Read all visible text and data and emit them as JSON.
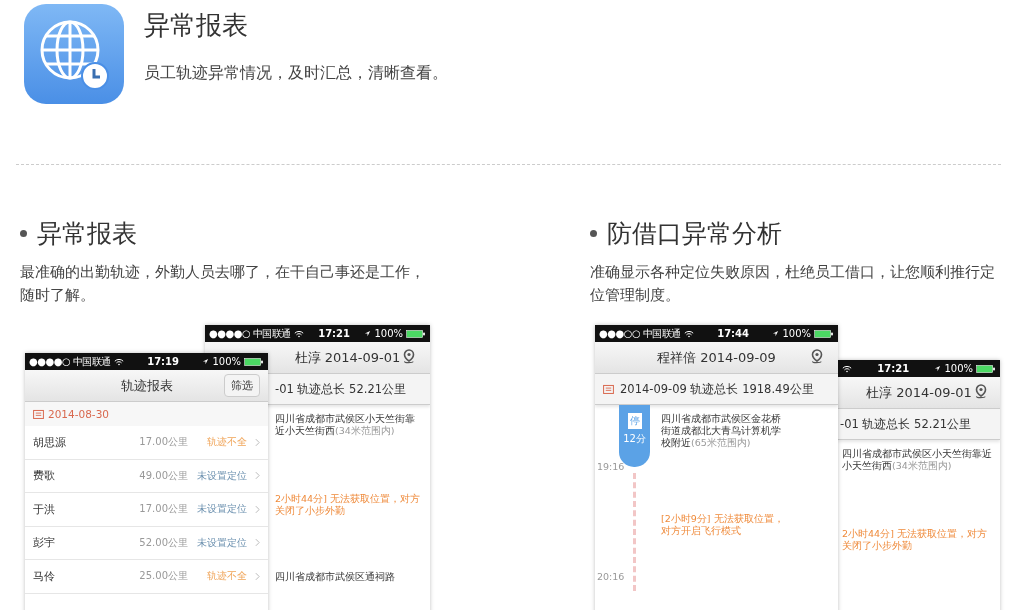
{
  "header": {
    "title": "异常报表",
    "subtitle": "员工轨迹异常情况，及时汇总，清晰查看。"
  },
  "sections": [
    {
      "title": "异常报表",
      "description": "最准确的出勤轨迹，外勤人员去哪了，在干自己事还是工作，随时了解。",
      "phones": [
        {
          "kind": "track",
          "status": {
            "carrier": "●●●●○ 中国联通",
            "time": "17:21",
            "battery": "100%"
          },
          "title": "杜淳 2014-09-01",
          "summary": "-01  轨迹总长 52.21公里",
          "entries": [
            {
              "kind": "address",
              "text": "四川省成都市武侯区小天竺街靠近小天竺街西",
              "note": "(34米范围内)"
            },
            {
              "kind": "gap",
              "text": "2小时44分] 无法获取位置，对方关闭了小步外勤"
            },
            {
              "kind": "address",
              "text": "四川省成都市武侯区通祠路"
            }
          ]
        },
        {
          "kind": "report",
          "status": {
            "carrier": "●●●●○ 中国联通",
            "time": "17:19",
            "battery": "100%"
          },
          "title": "轨迹报表",
          "filter_button": "筛选",
          "date": "2014-08-30",
          "rows": [
            {
              "name": "胡思源",
              "distance": "17.00公里",
              "state": "轨迹不全",
              "kind": "incomplete"
            },
            {
              "name": "费歌",
              "distance": "49.00公里",
              "state": "未设置定位",
              "kind": "unset"
            },
            {
              "name": "于洪",
              "distance": "17.00公里",
              "state": "未设置定位",
              "kind": "unset"
            },
            {
              "name": "彭宇",
              "distance": "52.00公里",
              "state": "未设置定位",
              "kind": "unset"
            },
            {
              "name": "马伶",
              "distance": "25.00公里",
              "state": "轨迹不全",
              "kind": "incomplete"
            }
          ]
        }
      ]
    },
    {
      "title": "防借口异常分析",
      "description": "准确显示各种定位失败原因，杜绝员工借口，让您顺利推行定位管理制度。",
      "phones": [
        {
          "kind": "track",
          "status": {
            "carrier": "●●●○○ 中国联通",
            "time": "17:44",
            "battery": "100%"
          },
          "title": "程祥倍 2014-09-09",
          "summary": "2014-09-09  轨迹总长 1918.49公里",
          "entries": [
            {
              "kind": "stop",
              "badge": "停",
              "duration": "12分",
              "text": "四川省成都市武侯区金花桥街道成都北大青鸟计算机学校附近",
              "note": "(65米范围内)",
              "time": "19:16"
            },
            {
              "kind": "gap",
              "text": "[2小时9分] 无法获取位置，对方开启飞行模式",
              "time": "20:16"
            }
          ]
        },
        {
          "kind": "track",
          "status": {
            "time": "17:21",
            "battery": "100%"
          },
          "title": "杜淳 2014-09-01",
          "summary": "-01  轨迹总长 52.21公里",
          "entries": [
            {
              "kind": "address",
              "text": "四川省成都市武侯区小天竺街靠近小天竺街西",
              "note": "(34米范围内)"
            },
            {
              "kind": "gap",
              "text": "2小时44分] 无法获取位置，对方关闭了小步外勤"
            }
          ]
        }
      ]
    }
  ]
}
